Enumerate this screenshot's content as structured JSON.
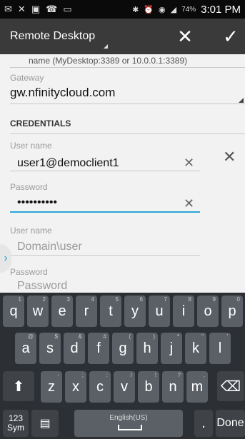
{
  "status_bar": {
    "left_icons": [
      "✉",
      "✕",
      "▣",
      "☎",
      "▭"
    ],
    "right_icons": [
      "✱",
      "⏰",
      "◉",
      "◢"
    ],
    "battery": "74%",
    "time": "3:01 PM"
  },
  "action_bar": {
    "title": "Remote Desktop",
    "close_label": "✕",
    "confirm_label": "✓"
  },
  "form": {
    "hint_text": "name (MyDesktop:3389 or 10.0.0.1:3389)",
    "gateway": {
      "label": "Gateway",
      "value": "gw.nfinitycloud.com"
    },
    "credentials_heading": "CREDENTIALS",
    "username1": {
      "label": "User name",
      "value": "user1@democlient1"
    },
    "password1": {
      "label": "Password",
      "value": "••••••••••"
    },
    "username2": {
      "label": "User name",
      "placeholder": "Domain\\user"
    },
    "password2": {
      "label": "Password",
      "placeholder": "Password"
    },
    "clear_glyph": "✕",
    "drawer_glyph": "›"
  },
  "keyboard": {
    "row1": [
      {
        "k": "q",
        "s": "1"
      },
      {
        "k": "w",
        "s": "2"
      },
      {
        "k": "e",
        "s": "3"
      },
      {
        "k": "r",
        "s": "4"
      },
      {
        "k": "t",
        "s": "5"
      },
      {
        "k": "y",
        "s": "6"
      },
      {
        "k": "u",
        "s": "7"
      },
      {
        "k": "i",
        "s": "8"
      },
      {
        "k": "o",
        "s": "9"
      },
      {
        "k": "p",
        "s": "0"
      }
    ],
    "row2": [
      {
        "k": "a",
        "s": "@"
      },
      {
        "k": "s",
        "s": "$"
      },
      {
        "k": "d",
        "s": "&"
      },
      {
        "k": "f",
        "s": "#"
      },
      {
        "k": "g",
        "s": "("
      },
      {
        "k": "h",
        "s": ")"
      },
      {
        "k": "j",
        "s": "*"
      },
      {
        "k": "k",
        "s": "\""
      },
      {
        "k": "l",
        "s": "'"
      }
    ],
    "row3": [
      {
        "k": "z",
        "s": "-"
      },
      {
        "k": "x",
        "s": ";"
      },
      {
        "k": "c",
        "s": ":"
      },
      {
        "k": "v",
        "s": "/"
      },
      {
        "k": "b",
        "s": "!"
      },
      {
        "k": "n",
        "s": "?"
      },
      {
        "k": "m",
        "s": ","
      }
    ],
    "shift_glyph": "⬆",
    "backspace_glyph": "⌫",
    "sym_label_top": "123",
    "sym_label_bottom": "Sym",
    "clipboard_glyph": "▤",
    "space_label": "English(US)",
    "period_label": ".",
    "done_label": "Done"
  }
}
